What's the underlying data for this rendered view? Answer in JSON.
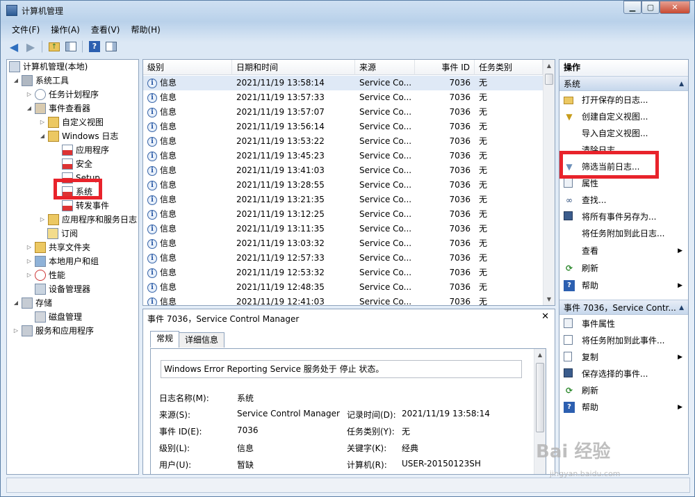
{
  "window": {
    "title": "计算机管理"
  },
  "menu": [
    "文件(F)",
    "操作(A)",
    "查看(V)",
    "帮助(H)"
  ],
  "tree": {
    "root": "计算机管理(本地)",
    "system_tools": "系统工具",
    "task_scheduler": "任务计划程序",
    "event_viewer": "事件查看器",
    "custom_views": "自定义视图",
    "windows_logs": "Windows 日志",
    "application": "应用程序",
    "security": "安全",
    "setup": "Setup",
    "system": "系统",
    "forwarded": "转发事件",
    "app_services_logs": "应用程序和服务日志",
    "subscriptions": "订阅",
    "shared_folders": "共享文件夹",
    "local_users": "本地用户和组",
    "performance": "性能",
    "device_manager": "设备管理器",
    "storage": "存储",
    "disk_management": "磁盘管理",
    "services_apps": "服务和应用程序"
  },
  "list": {
    "columns": [
      "级别",
      "日期和时间",
      "来源",
      "事件 ID",
      "任务类别"
    ],
    "rows": [
      {
        "level": "信息",
        "datetime": "2021/11/19 13:58:14",
        "source": "Service Co...",
        "id": "7036",
        "category": "无"
      },
      {
        "level": "信息",
        "datetime": "2021/11/19 13:57:33",
        "source": "Service Co...",
        "id": "7036",
        "category": "无"
      },
      {
        "level": "信息",
        "datetime": "2021/11/19 13:57:07",
        "source": "Service Co...",
        "id": "7036",
        "category": "无"
      },
      {
        "level": "信息",
        "datetime": "2021/11/19 13:56:14",
        "source": "Service Co...",
        "id": "7036",
        "category": "无"
      },
      {
        "level": "信息",
        "datetime": "2021/11/19 13:53:22",
        "source": "Service Co...",
        "id": "7036",
        "category": "无"
      },
      {
        "level": "信息",
        "datetime": "2021/11/19 13:45:23",
        "source": "Service Co...",
        "id": "7036",
        "category": "无"
      },
      {
        "level": "信息",
        "datetime": "2021/11/19 13:41:03",
        "source": "Service Co...",
        "id": "7036",
        "category": "无"
      },
      {
        "level": "信息",
        "datetime": "2021/11/19 13:28:55",
        "source": "Service Co...",
        "id": "7036",
        "category": "无"
      },
      {
        "level": "信息",
        "datetime": "2021/11/19 13:21:35",
        "source": "Service Co...",
        "id": "7036",
        "category": "无"
      },
      {
        "level": "信息",
        "datetime": "2021/11/19 13:12:25",
        "source": "Service Co...",
        "id": "7036",
        "category": "无"
      },
      {
        "level": "信息",
        "datetime": "2021/11/19 13:11:35",
        "source": "Service Co...",
        "id": "7036",
        "category": "无"
      },
      {
        "level": "信息",
        "datetime": "2021/11/19 13:03:32",
        "source": "Service Co...",
        "id": "7036",
        "category": "无"
      },
      {
        "level": "信息",
        "datetime": "2021/11/19 12:57:33",
        "source": "Service Co...",
        "id": "7036",
        "category": "无"
      },
      {
        "level": "信息",
        "datetime": "2021/11/19 12:53:32",
        "source": "Service Co...",
        "id": "7036",
        "category": "无"
      },
      {
        "level": "信息",
        "datetime": "2021/11/19 12:48:35",
        "source": "Service Co...",
        "id": "7036",
        "category": "无"
      },
      {
        "level": "信息",
        "datetime": "2021/11/19 12:41:03",
        "source": "Service Co...",
        "id": "7036",
        "category": "无"
      }
    ]
  },
  "detail": {
    "title": "事件 7036，Service Control Manager",
    "tabs": [
      "常规",
      "详细信息"
    ],
    "description": "Windows Error Reporting Service 服务处于 停止 状态。",
    "log_name_label": "日志名称(M):",
    "log_name": "系统",
    "source_label": "来源(S):",
    "source": "Service Control Manager",
    "logged_label": "记录时间(D):",
    "logged": "2021/11/19 13:58:14",
    "event_id_label": "事件 ID(E):",
    "event_id": "7036",
    "task_label": "任务类别(Y):",
    "task": "无",
    "level_label": "级别(L):",
    "level": "信息",
    "keywords_label": "关键字(K):",
    "keywords": "经典",
    "user_label": "用户(U):",
    "user": "暂缺",
    "computer_label": "计算机(R):",
    "computer": "USER-20150123SH"
  },
  "actions": {
    "header": "操作",
    "section1": "系统",
    "items1": [
      "打开保存的日志...",
      "创建自定义视图...",
      "导入自定义视图...",
      "清除日志...",
      "筛选当前日志...",
      "属性",
      "查找...",
      "将所有事件另存为...",
      "将任务附加到此日志...",
      "查看",
      "刷新",
      "帮助"
    ],
    "section2": "事件 7036，Service Contr...",
    "items2": [
      "事件属性",
      "将任务附加到此事件...",
      "复制",
      "保存选择的事件...",
      "刷新",
      "帮助"
    ]
  },
  "watermark": {
    "brand": "Bai 经验",
    "url": "jingyan.baidu.com"
  },
  "colors": {
    "highlight": "#e8232b",
    "selected_row": "#dfe9f6",
    "section_header": "#c6d7ec"
  }
}
